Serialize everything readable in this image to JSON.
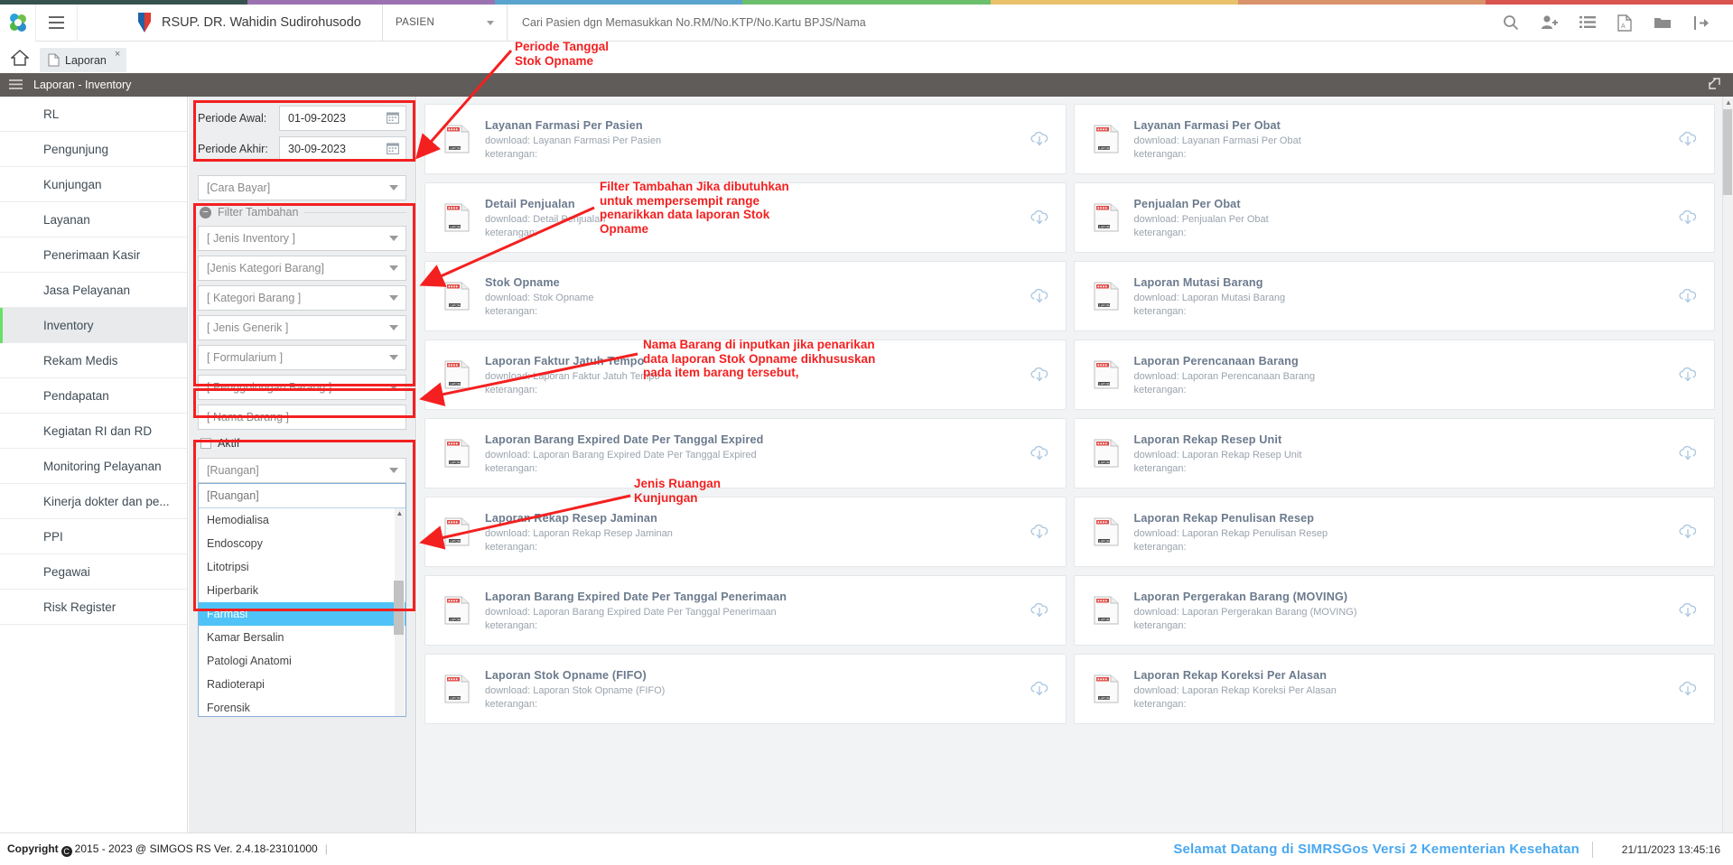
{
  "topbar_colors": [
    "#36514e",
    "#9b72b0",
    "#5ba3cf",
    "#6cbf6c",
    "#e8c16a",
    "#d9926a",
    "#d9534f"
  ],
  "header": {
    "logo_icon": "simgos-logo-icon",
    "menu_icon": "hamburger-icon",
    "hospital_icon": "hospital-badge-icon",
    "hospital_name": "RSUP. DR. Wahidin Sudirohusodo",
    "context_select": "PASIEN",
    "search_placeholder": "Cari Pasien dgn Memasukkan No.RM/No.KTP/No.Kartu BPJS/Nama",
    "icons": [
      {
        "name": "search-icon",
        "title": "Cari"
      },
      {
        "name": "add-user-icon",
        "title": "Tambah Pasien"
      },
      {
        "name": "list-icon",
        "title": "Daftar"
      },
      {
        "name": "pdf-file-icon",
        "title": "PDF"
      },
      {
        "name": "folder-icon",
        "title": "Berkas"
      },
      {
        "name": "logout-icon",
        "title": "Keluar"
      }
    ]
  },
  "tabs": {
    "home_icon": "home-icon",
    "items": [
      {
        "label": "Laporan",
        "icon": "document-icon",
        "close": "×",
        "active": true
      }
    ]
  },
  "pagebar": {
    "menu_icon": "bars-icon",
    "title": "Laporan - Inventory",
    "expand_icon": "expand-icon"
  },
  "sidebar": {
    "items": [
      {
        "label": "RL",
        "active": false
      },
      {
        "label": "Pengunjung",
        "active": false
      },
      {
        "label": "Kunjungan",
        "active": false
      },
      {
        "label": "Layanan",
        "active": false
      },
      {
        "label": "Penerimaan Kasir",
        "active": false
      },
      {
        "label": "Jasa Pelayanan",
        "active": false
      },
      {
        "label": "Inventory",
        "active": true
      },
      {
        "label": "Rekam Medis",
        "active": false
      },
      {
        "label": "Pendapatan",
        "active": false
      },
      {
        "label": "Kegiatan RI dan RD",
        "active": false
      },
      {
        "label": "Monitoring Pelayanan",
        "active": false
      },
      {
        "label": "Kinerja dokter dan pe...",
        "active": false
      },
      {
        "label": "PPI",
        "active": false
      },
      {
        "label": "Pegawai",
        "active": false
      },
      {
        "label": "Risk Register",
        "active": false
      }
    ]
  },
  "filter": {
    "periode_awal_label": "Periode Awal:",
    "periode_awal_value": "01-09-2023",
    "periode_akhir_label": "Periode Akhir:",
    "periode_akhir_value": "30-09-2023",
    "calendar_icon": "calendar-icon",
    "cara_bayar": "[Cara Bayar]",
    "fieldset_title": "Filter Tambahan",
    "collapse_icon": "minus-icon",
    "selects": [
      "[ Jenis Inventory ]",
      "[Jenis Kategori Barang]",
      "[ Kategori Barang ]",
      "[ Jenis Generik ]",
      "[ Formularium ]",
      "[ Penggolongan Barang ]"
    ],
    "nama_barang": "[ Nama Barang ]",
    "aktif_label": "Aktif",
    "ruangan_value": "[Ruangan]",
    "ruangan_search_placeholder": "[Ruangan]",
    "ruangan_options": [
      {
        "label": "Hemodialisa",
        "selected": false
      },
      {
        "label": "Endoscopy",
        "selected": false
      },
      {
        "label": "Litotripsi",
        "selected": false
      },
      {
        "label": "Hiperbarik",
        "selected": false
      },
      {
        "label": "Farmasi",
        "selected": true
      },
      {
        "label": "Kamar Bersalin",
        "selected": false
      },
      {
        "label": "Patologi Anatomi",
        "selected": false
      },
      {
        "label": "Radioterapi",
        "selected": false
      },
      {
        "label": "Forensik",
        "selected": false
      }
    ]
  },
  "reports": {
    "download_prefix": "download: ",
    "keterangan_label": "keterangan:",
    "file_icon": "report-file-icon",
    "download_icon": "cloud-download-icon",
    "left_column": [
      "Layanan Farmasi Per Pasien",
      "Detail Penjualan",
      "Stok Opname",
      "Laporan Faktur Jatuh Tempo",
      "Laporan Barang Expired Date Per Tanggal Expired",
      "Laporan Rekap Resep Jaminan",
      "Laporan Barang Expired Date Per Tanggal Penerimaan",
      "Laporan Stok Opname (FIFO)"
    ],
    "right_column": [
      "Layanan Farmasi Per Obat",
      "Penjualan Per Obat",
      "Laporan Mutasi Barang",
      "Laporan Perencanaan Barang",
      "Laporan Rekap Resep Unit",
      "Laporan Rekap Penulisan Resep",
      "Laporan Pergerakan Barang (MOVING)",
      "Laporan Rekap Koreksi Per Alasan"
    ]
  },
  "annotations": [
    {
      "id": "a1",
      "text": "Periode Tanggal\nStok Opname"
    },
    {
      "id": "a2",
      "text": "Filter Tambahan Jika dibutuhkan\nuntuk mempersempit range\npenarikkan data laporan Stok\nOpname"
    },
    {
      "id": "a3",
      "text": "Nama Barang di inputkan jika penarikan\ndata laporan Stok Opname dikhususkan\npada item barang tersebut,"
    },
    {
      "id": "a4",
      "text": "Jenis Ruangan\nKunjungan"
    }
  ],
  "footer": {
    "copyright_prefix": "Copyright",
    "copyright_mark": "C",
    "copyright_text": "2015 - 2023 @ SIMGOS RS Ver. 2.4.18-23101000",
    "welcome": "Selamat Datang di SIMRSGos Versi 2 Kementerian Kesehatan",
    "clock": "21/11/2023 13:45:16"
  },
  "colors": {
    "accent_red": "#f42020",
    "page_bar": "#605c59",
    "active_green": "#67e067",
    "welcome_blue": "#4aa8f0",
    "select_highlight": "#4fc3f7"
  }
}
